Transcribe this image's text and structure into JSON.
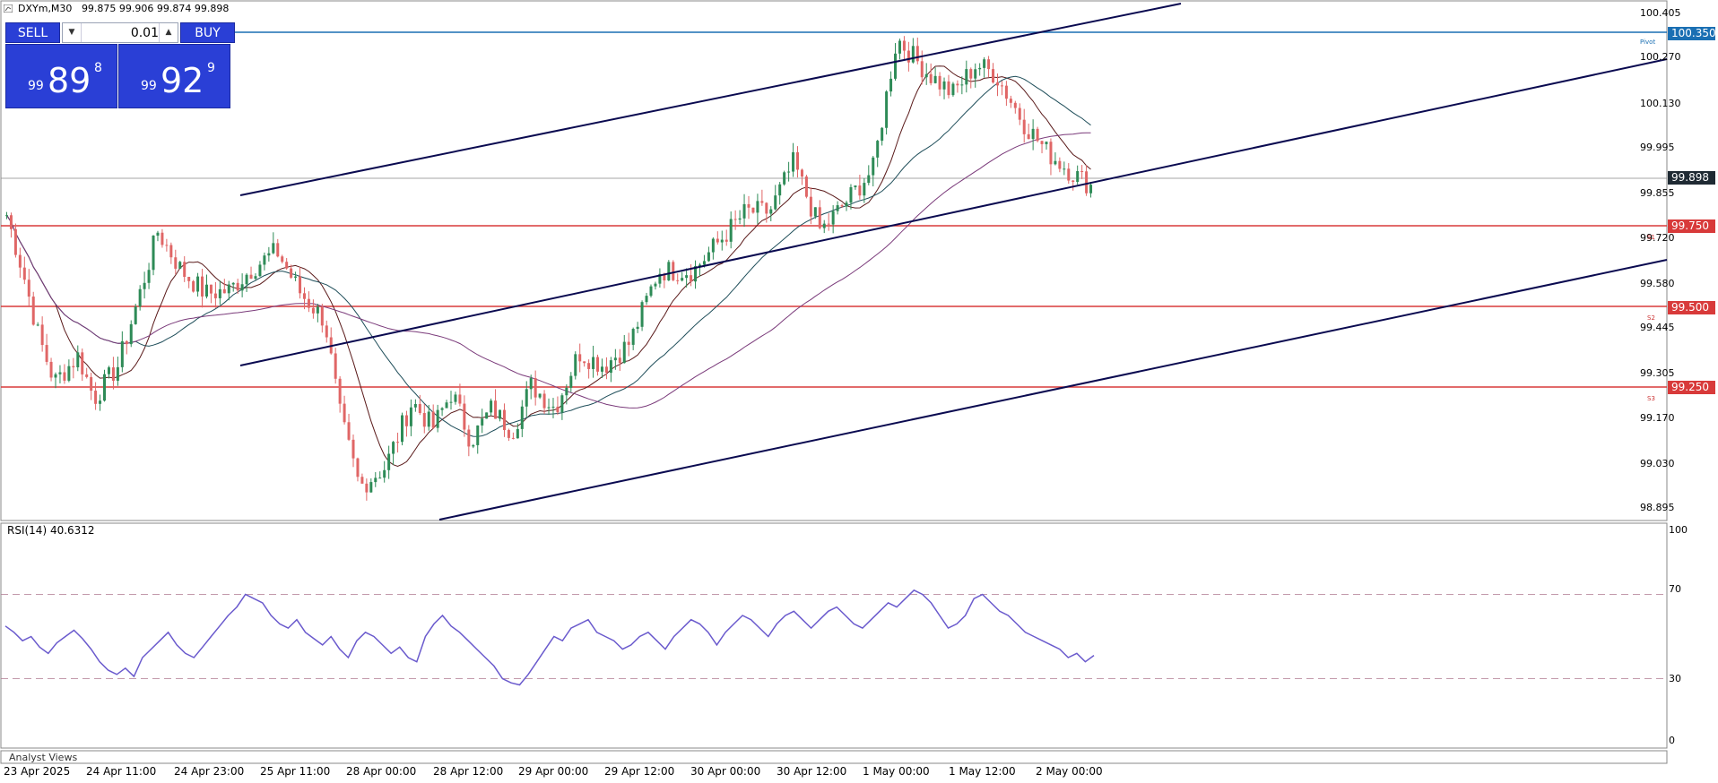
{
  "header": {
    "symbol_timeframe": "DXYm,M30",
    "ohlc": "99.875 99.906 99.874 99.898"
  },
  "trade_panel": {
    "sell_label": "SELL",
    "buy_label": "BUY",
    "lot_value": "0.01",
    "sell_price": {
      "prefix": "99",
      "big": "89",
      "sup": "8"
    },
    "buy_price": {
      "prefix": "99",
      "big": "92",
      "sup": "9"
    }
  },
  "price_axis": {
    "ticks": [
      "100.405",
      "100.270",
      "100.130",
      "99.995",
      "99.855",
      "99.720",
      "99.580",
      "99.445",
      "99.305",
      "99.170",
      "99.030",
      "98.895"
    ],
    "current_price": "99.898",
    "pivot_price": "100.350",
    "levels": [
      {
        "price": "99.750",
        "tag": "S1"
      },
      {
        "price": "99.500",
        "tag": "S2"
      },
      {
        "price": "99.250",
        "tag": "S3"
      }
    ],
    "pivot_tag": "Pivot"
  },
  "time_axis": {
    "labels": [
      "23 Apr 2025",
      "24 Apr 11:00",
      "24 Apr 23:00",
      "25 Apr 11:00",
      "28 Apr 00:00",
      "28 Apr 12:00",
      "29 Apr 00:00",
      "29 Apr 12:00",
      "30 Apr 00:00",
      "30 Apr 12:00",
      "1 May 00:00",
      "1 May 12:00",
      "2 May 00:00"
    ]
  },
  "rsi": {
    "title": "RSI(14) 40.6312",
    "axis": [
      "100",
      "70",
      "30",
      "0"
    ]
  },
  "footer": {
    "analyst_label": "Analyst Views"
  },
  "colors": {
    "bull": "#2e8b57",
    "bear": "#e06666",
    "level_line": "#d83a3a",
    "pivot_line": "#1a6fb3",
    "channel": "#0a0a50",
    "rsi_line": "#6a5acd",
    "ma_fast": "#5a1a1a",
    "ma_mid": "#1f4e5a",
    "ma_slow": "#7a3a7a"
  },
  "chart_data": {
    "type": "candlestick",
    "ylim": [
      98.86,
      100.43
    ],
    "rsi_levels": [
      70,
      30
    ],
    "rsi_values": [
      55,
      52,
      48,
      50,
      45,
      42,
      47,
      50,
      53,
      49,
      44,
      38,
      34,
      32,
      35,
      31,
      40,
      44,
      48,
      52,
      46,
      42,
      40,
      45,
      50,
      55,
      60,
      64,
      70,
      68,
      66,
      60,
      56,
      54,
      58,
      52,
      49,
      46,
      50,
      44,
      40,
      48,
      52,
      50,
      46,
      42,
      45,
      40,
      38,
      50,
      56,
      60,
      55,
      52,
      48,
      44,
      40,
      36,
      30,
      28,
      27,
      32,
      38,
      44,
      50,
      48,
      54,
      56,
      58,
      52,
      50,
      48,
      44,
      46,
      50,
      52,
      48,
      44,
      50,
      54,
      58,
      56,
      52,
      46,
      52,
      56,
      60,
      58,
      54,
      50,
      56,
      60,
      62,
      58,
      54,
      58,
      62,
      64,
      60,
      56,
      54,
      58,
      62,
      66,
      64,
      68,
      72,
      70,
      66,
      60,
      54,
      56,
      60,
      68,
      70,
      66,
      62,
      60,
      56,
      52,
      50,
      48,
      46,
      44,
      40,
      42,
      38,
      41
    ]
  }
}
